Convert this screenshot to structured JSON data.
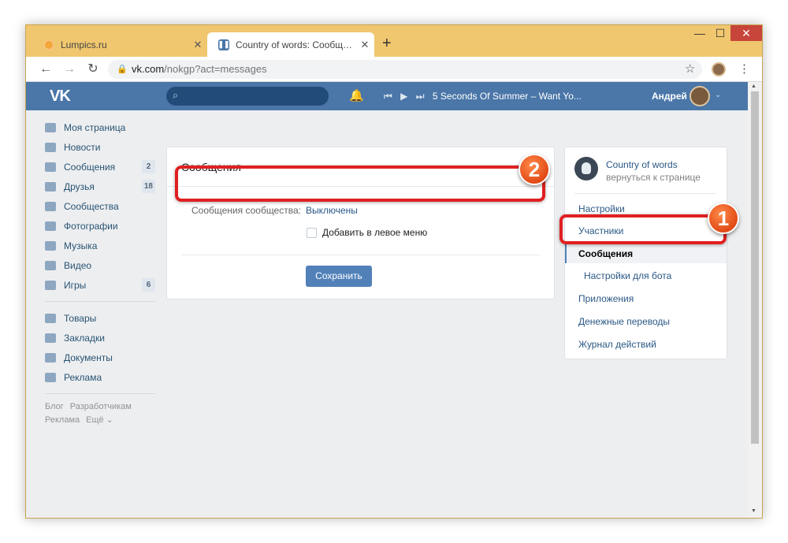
{
  "browser": {
    "tabs": [
      {
        "title": "Lumpics.ru",
        "icon": "lumpics-favicon",
        "active": false
      },
      {
        "title": "Country of words: Сообщения",
        "icon": "vk-favicon",
        "active": true
      }
    ],
    "new_tab_glyph": "+",
    "close_glyph": "✕",
    "window_controls": {
      "minimize": "—",
      "maximize": "☐",
      "close": "✕"
    },
    "url_host": "vk.com",
    "url_path": "/nokgp?act=messages"
  },
  "vk": {
    "logo": "VK",
    "search_placeholder": "",
    "player": {
      "prev": "⏮",
      "play": "▶",
      "next": "⏭",
      "track": "5 Seconds Of Summer – Want Yo..."
    },
    "user_name": "Андрей",
    "accent_color": "#4a76a8"
  },
  "left_menu": {
    "items": [
      {
        "label": "Моя страница",
        "icon": "home-icon"
      },
      {
        "label": "Новости",
        "icon": "news-icon"
      },
      {
        "label": "Сообщения",
        "icon": "message-icon",
        "count": "2"
      },
      {
        "label": "Друзья",
        "icon": "user-icon",
        "count": "18"
      },
      {
        "label": "Сообщества",
        "icon": "group-icon"
      },
      {
        "label": "Фотографии",
        "icon": "camera-icon"
      },
      {
        "label": "Музыка",
        "icon": "music-icon"
      },
      {
        "label": "Видео",
        "icon": "video-icon"
      },
      {
        "label": "Игры",
        "icon": "gamepad-icon",
        "count": "6"
      }
    ],
    "items2": [
      {
        "label": "Товары",
        "icon": "bag-icon"
      },
      {
        "label": "Закладки",
        "icon": "star-icon"
      },
      {
        "label": "Документы",
        "icon": "document-icon"
      },
      {
        "label": "Реклама",
        "icon": "megaphone-icon"
      }
    ],
    "footer": {
      "blog": "Блог",
      "dev": "Разработчикам",
      "ads": "Реклама",
      "more": "Ещё ⌄"
    }
  },
  "main": {
    "title": "Сообщения",
    "setting_label": "Сообщения сообщества:",
    "setting_value": "Выключены",
    "checkbox_label": "Добавить в левое меню",
    "checkbox_checked": false,
    "save_label": "Сохранить"
  },
  "right_menu": {
    "group_name": "Country of words",
    "back_link": "вернуться к странице",
    "items": [
      {
        "label": "Настройки"
      },
      {
        "label": "Участники"
      },
      {
        "label": "Сообщения",
        "active": true
      },
      {
        "label": "Настройки для бота",
        "sub": true
      },
      {
        "label": "Приложения"
      },
      {
        "label": "Денежные переводы"
      },
      {
        "label": "Журнал действий"
      }
    ]
  },
  "annotations": {
    "step1": "1",
    "step2": "2",
    "color": "#e02020"
  }
}
